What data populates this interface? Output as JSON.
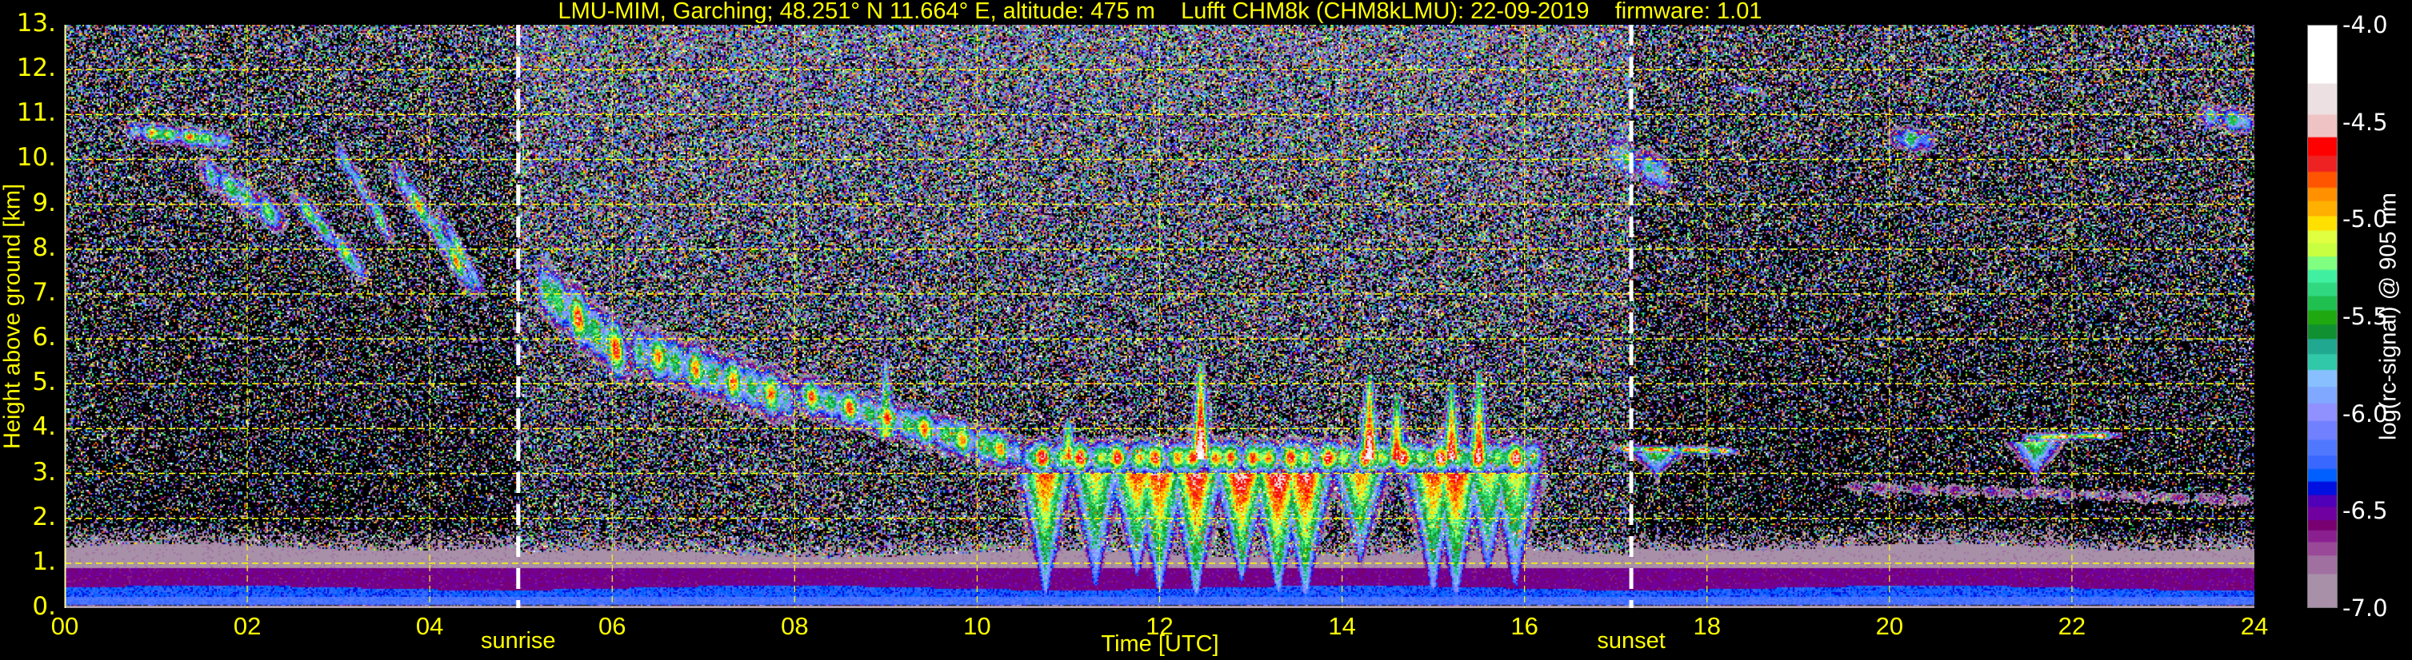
{
  "title": "LMU-MIM, Garching; 48.251° N 11.664° E, altitude: 475 m    Lufft CHM8k (CHM8kLMU): 22-09-2019    firmware: 1.01",
  "chart_data": {
    "type": "heatmap",
    "xlabel": "Time [UTC]",
    "ylabel": "Height above ground [km]",
    "xlim": [
      0,
      24
    ],
    "ylim": [
      0,
      13
    ],
    "grid": true,
    "x_ticks": [
      "00",
      "02",
      "04",
      "06",
      "08",
      "10",
      "12",
      "14",
      "16",
      "18",
      "20",
      "22",
      "24"
    ],
    "y_ticks": [
      "0.",
      "1.",
      "2.",
      "3.",
      "4.",
      "5.",
      "6.",
      "7.",
      "8.",
      "9.",
      "10.",
      "11.",
      "12.",
      "13."
    ],
    "annotations": [
      {
        "label": "sunrise",
        "time": 4.97
      },
      {
        "label": "sunset",
        "time": 17.17
      }
    ],
    "colorbar": {
      "label": "log(rc-signal) @ 905 nm",
      "range": [
        -7.0,
        -4.0
      ],
      "tick_labels": [
        "-4.0",
        "-4.5",
        "-5.0",
        "-5.5",
        "-6.0",
        "-6.5",
        "-7.0"
      ],
      "tick_values": [
        -4.0,
        -4.5,
        -5.0,
        -5.5,
        -6.0,
        -6.5,
        -7.0
      ],
      "bin_lower_bounds": [
        -4.299,
        -4.459,
        -4.576,
        -4.671,
        -4.754,
        -4.836,
        -4.905,
        -4.983,
        -5.057,
        -5.122,
        -5.191,
        -5.26,
        -5.326,
        -5.395,
        -5.469,
        -5.542,
        -5.616,
        -5.694,
        -5.776,
        -5.863,
        -5.949,
        -6.04,
        -6.136,
        -6.218,
        -6.287,
        -6.352,
        -6.421,
        -6.482,
        -6.551,
        -6.603,
        -6.664,
        -6.733,
        -6.829,
        -7.0
      ],
      "colors": [
        "#ffffff",
        "#ece0e2",
        "#efc3c3",
        "#ff0000",
        "#ee2222",
        "#ff5500",
        "#ff9000",
        "#ffb000",
        "#ffe000",
        "#e0ff40",
        "#c8ff40",
        "#80ff80",
        "#40f0a0",
        "#30d880",
        "#20c050",
        "#20a810",
        "#109030",
        "#20a890",
        "#30c8a8",
        "#88c0ff",
        "#80a8ff",
        "#9090ff",
        "#7080ff",
        "#5078ff",
        "#3868ff",
        "#0060ff",
        "#0010e0",
        "#5000b8",
        "#7000a0",
        "#780070",
        "#8a2090",
        "#9a4898",
        "#a070a0",
        "#a890a8"
      ]
    },
    "boundary_layer": {
      "top_km": 1.35,
      "blue_band_km": [
        0.12,
        0.45
      ],
      "value_blue": -6.25,
      "value_purple": -6.55,
      "value_top": -6.88
    },
    "layers": [
      {
        "name": "cirrus-1",
        "t": [
          0.7,
          1.8
        ],
        "h": [
          10.65,
          10.4
        ],
        "depth": 0.3,
        "peak": -4.7
      },
      {
        "name": "cirrus-2",
        "t": [
          1.5,
          2.4
        ],
        "h": [
          9.8,
          8.6
        ],
        "depth": 0.5,
        "peak": -5.1
      },
      {
        "name": "cirrus-3",
        "t": [
          2.5,
          3.3
        ],
        "h": [
          9.2,
          7.4
        ],
        "depth": 0.4,
        "peak": -5.0
      },
      {
        "name": "cirrus-4",
        "t": [
          3.0,
          3.6
        ],
        "h": [
          10.2,
          8.2
        ],
        "depth": 0.4,
        "peak": -5.2
      },
      {
        "name": "cirrus-5",
        "t": [
          3.6,
          4.5
        ],
        "h": [
          9.8,
          7.1
        ],
        "depth": 0.45,
        "peak": -4.8
      },
      {
        "name": "cirrus-6",
        "t": [
          4.1,
          4.6
        ],
        "h": [
          8.8,
          7.0
        ],
        "depth": 0.35,
        "peak": -5.0
      },
      {
        "name": "midcloud-1",
        "t": [
          5.2,
          6.2
        ],
        "h": [
          7.2,
          5.5
        ],
        "depth": 0.9,
        "peak": -4.6
      },
      {
        "name": "midcloud-2",
        "t": [
          6.2,
          8.0
        ],
        "h": [
          5.8,
          4.6
        ],
        "depth": 0.8,
        "peak": -4.8
      },
      {
        "name": "midcloud-3",
        "t": [
          8.0,
          10.5
        ],
        "h": [
          4.8,
          3.4
        ],
        "depth": 0.6,
        "peak": -4.7
      },
      {
        "name": "stratocumulus",
        "t": [
          10.5,
          16.2
        ],
        "h": [
          3.35,
          3.35
        ],
        "depth": 0.55,
        "peak": -4.4
      },
      {
        "name": "evening-layer-1",
        "t": [
          17.0,
          18.3
        ],
        "h": [
          3.55,
          3.5
        ],
        "depth": 0.12,
        "peak": -4.1
      },
      {
        "name": "evening-layer-2",
        "t": [
          21.5,
          22.5
        ],
        "h": [
          3.8,
          3.85
        ],
        "depth": 0.12,
        "peak": -4.1
      },
      {
        "name": "faint-cirrus-1",
        "t": [
          16.9,
          17.6
        ],
        "h": [
          10.2,
          9.6
        ],
        "depth": 0.6,
        "peak": -5.4
      },
      {
        "name": "faint-cirrus-2",
        "t": [
          20.0,
          20.5
        ],
        "h": [
          10.5,
          10.4
        ],
        "depth": 0.4,
        "peak": -5.4
      },
      {
        "name": "faint-cirrus-3",
        "t": [
          23.4,
          24.0
        ],
        "h": [
          11.0,
          10.8
        ],
        "depth": 0.4,
        "peak": -5.3
      },
      {
        "name": "cirrus-speck",
        "t": [
          18.3,
          18.6
        ],
        "h": [
          11.6,
          11.5
        ],
        "depth": 0.1,
        "peak": -4.6
      },
      {
        "name": "aerosol-layer",
        "t": [
          19.5,
          24.0
        ],
        "h": [
          2.7,
          2.4
        ],
        "depth": 0.25,
        "peak": -6.45
      }
    ],
    "fallstreaks": [
      {
        "t": 10.75,
        "top": 3.0,
        "bottom": 0.4,
        "peak": -4.7
      },
      {
        "t": 11.3,
        "top": 3.0,
        "bottom": 0.6,
        "peak": -5.0
      },
      {
        "t": 11.75,
        "top": 3.0,
        "bottom": 0.9,
        "peak": -4.7
      },
      {
        "t": 12.0,
        "top": 3.0,
        "bottom": 0.5,
        "peak": -4.6
      },
      {
        "t": 12.4,
        "top": 3.0,
        "bottom": 0.4,
        "peak": -4.5
      },
      {
        "t": 12.9,
        "top": 3.0,
        "bottom": 0.8,
        "peak": -4.4
      },
      {
        "t": 13.3,
        "top": 3.0,
        "bottom": 0.5,
        "peak": -4.4
      },
      {
        "t": 13.6,
        "top": 3.0,
        "bottom": 0.4,
        "peak": -4.5
      },
      {
        "t": 14.2,
        "top": 3.0,
        "bottom": 1.2,
        "peak": -4.8
      },
      {
        "t": 15.0,
        "top": 3.0,
        "bottom": 0.5,
        "peak": -4.7
      },
      {
        "t": 15.25,
        "top": 3.0,
        "bottom": 0.4,
        "peak": -4.6
      },
      {
        "t": 15.6,
        "top": 3.0,
        "bottom": 1.0,
        "peak": -5.0
      },
      {
        "t": 15.9,
        "top": 3.0,
        "bottom": 0.6,
        "peak": -5.0
      },
      {
        "t": 17.45,
        "top": 3.45,
        "bottom": 3.0,
        "peak": -5.3
      },
      {
        "t": 21.6,
        "top": 3.7,
        "bottom": 3.0,
        "peak": -5.2
      }
    ],
    "convective_tops": [
      {
        "t": 12.45,
        "base": 3.3,
        "top": 5.5,
        "peak": -4.1
      },
      {
        "t": 14.3,
        "base": 3.3,
        "top": 5.2,
        "peak": -4.2
      },
      {
        "t": 14.6,
        "base": 3.3,
        "top": 4.8,
        "peak": -4.5
      },
      {
        "t": 15.2,
        "base": 3.3,
        "top": 5.0,
        "peak": -4.4
      },
      {
        "t": 15.5,
        "base": 3.3,
        "top": 5.3,
        "peak": -4.5
      },
      {
        "t": 11.0,
        "base": 3.3,
        "top": 4.2,
        "peak": -4.7
      },
      {
        "t": 9.0,
        "base": 3.8,
        "top": 5.5,
        "peak": -5.0
      }
    ]
  }
}
